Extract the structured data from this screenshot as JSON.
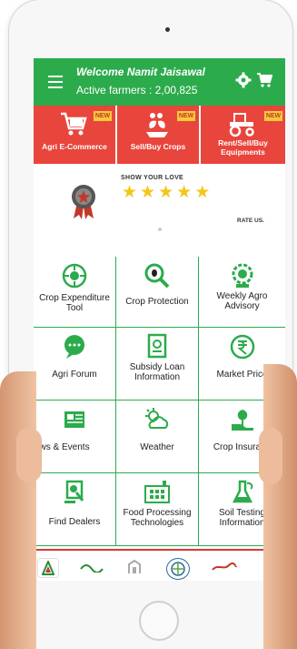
{
  "header": {
    "welcome": "Welcome Namit Jaisawal",
    "farmers": "Active farmers : 2,00,825",
    "menu_icon": "hamburger-menu-icon",
    "settings_icon": "gear-icon",
    "cart_icon": "cart-icon",
    "color": "#2cab4c"
  },
  "feature_tiles": [
    {
      "label": "Agri E-Commerce",
      "badge": "NEW",
      "icon": "shopping-cart-icon"
    },
    {
      "label": "Sell/Buy Crops",
      "badge": "NEW",
      "icon": "plant-hand-icon"
    },
    {
      "label": "Rent/Sell/Buy\nEquipments",
      "badge": "NEW",
      "icon": "tractor-icon"
    }
  ],
  "rating": {
    "show_love": "SHOW YOUR LOVE",
    "stars": 5,
    "rate_us": "RATE US."
  },
  "grid": [
    {
      "label": "Crop Expenditure\nTool",
      "icon": "expenditure-icon"
    },
    {
      "label": "Crop Protection",
      "icon": "magnifier-bug-icon"
    },
    {
      "label": "Weekly Agro\nAdvisory",
      "icon": "advisory-gear-icon"
    },
    {
      "label": "Agri Forum",
      "icon": "chat-bubble-icon"
    },
    {
      "label": "Subsidy Loan\nInformation",
      "icon": "document-icon"
    },
    {
      "label": "Market Price",
      "icon": "rupee-icon"
    },
    {
      "label": "ews & Events",
      "icon": "news-icon"
    },
    {
      "label": "Weather",
      "icon": "weather-icon"
    },
    {
      "label": "Crop Insurand",
      "icon": "crop-insurance-icon"
    },
    {
      "label": "Find Dealers",
      "icon": "dealer-icon"
    },
    {
      "label": "Food Processing\nTechnologies",
      "icon": "factory-icon"
    },
    {
      "label": "Soil Testing\nInformation",
      "icon": "soil-test-icon"
    }
  ],
  "partners": [
    "partner-logo-1",
    "partner-logo-2",
    "partner-logo-3",
    "partner-logo-4",
    "partner-logo-5"
  ],
  "colors": {
    "accent_green": "#2cab4c",
    "tile_red": "#e8453c",
    "badge_yellow": "#f8c93a",
    "star": "#f5c518"
  }
}
